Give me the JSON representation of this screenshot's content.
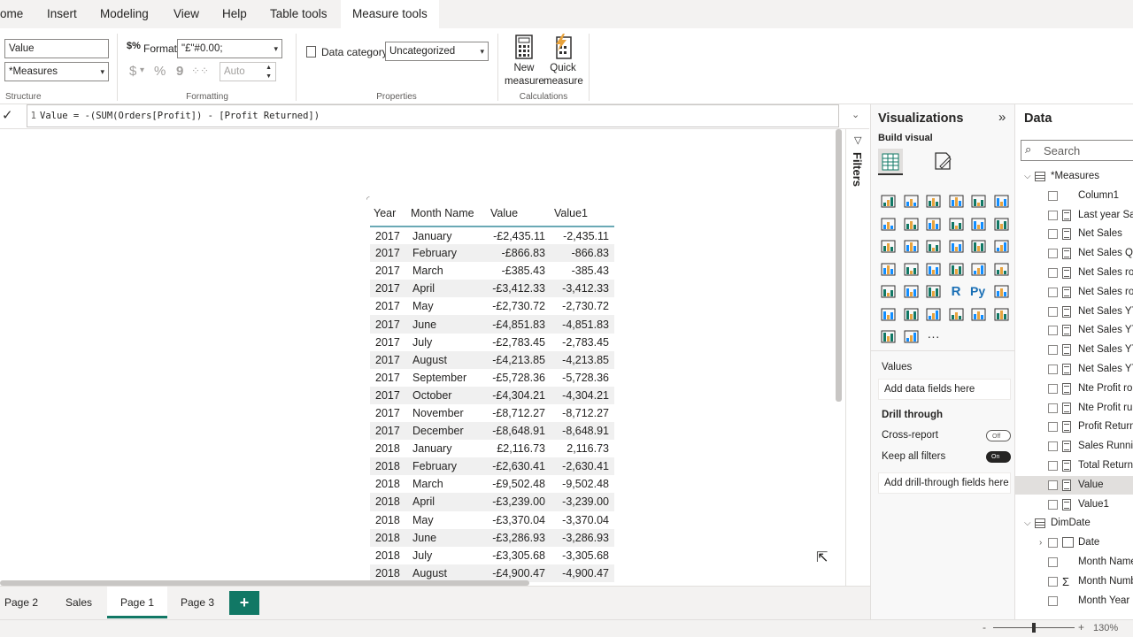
{
  "menu": {
    "items": [
      "ome",
      "Insert",
      "Modeling",
      "View",
      "Help",
      "Table tools",
      "Measure tools"
    ],
    "active": "Measure tools"
  },
  "ribbon": {
    "structure": {
      "name_value": "Value",
      "home_table": "*Measures",
      "label": "Structure"
    },
    "formatting": {
      "format_label": "Format",
      "format_value": "\"£\"#0.00;",
      "currency_symbol": "$",
      "comma_symbol": "9",
      "decimals_value": "Auto",
      "label": "Formatting"
    },
    "properties": {
      "data_category_label": "Data category",
      "data_category_value": "Uncategorized",
      "label": "Properties"
    },
    "calculations": {
      "new_measure_line1": "New",
      "new_measure_line2": "measure",
      "quick_measure_line1": "Quick",
      "quick_measure_line2": "measure",
      "label": "Calculations"
    }
  },
  "formula": {
    "line_number": "1",
    "text": "Value = -(SUM(Orders[Profit]) - [Profit Returned])"
  },
  "table": {
    "headers": [
      "Year",
      "Month Name",
      "Value",
      "Value1"
    ],
    "rows": [
      [
        "2017",
        "January",
        "-£2,435.11",
        "-2,435.11"
      ],
      [
        "2017",
        "February",
        "-£866.83",
        "-866.83"
      ],
      [
        "2017",
        "March",
        "-£385.43",
        "-385.43"
      ],
      [
        "2017",
        "April",
        "-£3,412.33",
        "-3,412.33"
      ],
      [
        "2017",
        "May",
        "-£2,730.72",
        "-2,730.72"
      ],
      [
        "2017",
        "June",
        "-£4,851.83",
        "-4,851.83"
      ],
      [
        "2017",
        "July",
        "-£2,783.45",
        "-2,783.45"
      ],
      [
        "2017",
        "August",
        "-£4,213.85",
        "-4,213.85"
      ],
      [
        "2017",
        "September",
        "-£5,728.36",
        "-5,728.36"
      ],
      [
        "2017",
        "October",
        "-£4,304.21",
        "-4,304.21"
      ],
      [
        "2017",
        "November",
        "-£8,712.27",
        "-8,712.27"
      ],
      [
        "2017",
        "December",
        "-£8,648.91",
        "-8,648.91"
      ],
      [
        "2018",
        "January",
        "£2,116.73",
        "2,116.73"
      ],
      [
        "2018",
        "February",
        "-£2,630.41",
        "-2,630.41"
      ],
      [
        "2018",
        "March",
        "-£9,502.48",
        "-9,502.48"
      ],
      [
        "2018",
        "April",
        "-£3,239.00",
        "-3,239.00"
      ],
      [
        "2018",
        "May",
        "-£3,370.04",
        "-3,370.04"
      ],
      [
        "2018",
        "June",
        "-£3,286.93",
        "-3,286.93"
      ],
      [
        "2018",
        "July",
        "-£3,305.68",
        "-3,305.68"
      ],
      [
        "2018",
        "August",
        "-£4,900.47",
        "-4,900.47"
      ]
    ]
  },
  "filters": {
    "label": "Filters"
  },
  "pages": {
    "tabs": [
      "Page 2",
      "Sales",
      "Page 1",
      "Page 3"
    ],
    "active": "Page 1",
    "add_label": "+"
  },
  "status": {
    "zoom": "130%",
    "minus": "-",
    "plus": "+"
  },
  "visualizations": {
    "title": "Visualizations",
    "build_visual": "Build visual",
    "values_label": "Values",
    "values_placeholder": "Add data fields here",
    "drill_through_label": "Drill through",
    "cross_report_label": "Cross-report",
    "cross_report_state": "Off",
    "keep_filters_label": "Keep all filters",
    "keep_filters_state": "On",
    "drillthrough_placeholder": "Add drill-through fields here",
    "more": "···",
    "r_label": "R",
    "py_label": "Py"
  },
  "data_pane": {
    "title": "Data",
    "search_placeholder": "Search",
    "tables": [
      {
        "name": "*Measures",
        "fields": [
          "Column1",
          "Last year Sale",
          "Net Sales",
          "Net Sales Qc",
          "Net Sales rol",
          "Net Sales rol",
          "Net Sales YT",
          "Net Sales YT",
          "Net Sales YT",
          "Net Sales YT",
          "Nte Profit rol",
          "Nte Profit ru",
          "Profit Returne",
          "Sales Runnin",
          "Total Returns",
          "Value",
          "Value1"
        ]
      },
      {
        "name": "DimDate",
        "fields": [
          "Date",
          "Month Name",
          "Month Numb",
          "Month Year"
        ]
      }
    ],
    "selected_field": "Value"
  },
  "colors": {
    "accent": "#117865",
    "table_header_line": "#6aa9b5",
    "ribbon_bg": "#f3f2f1"
  }
}
